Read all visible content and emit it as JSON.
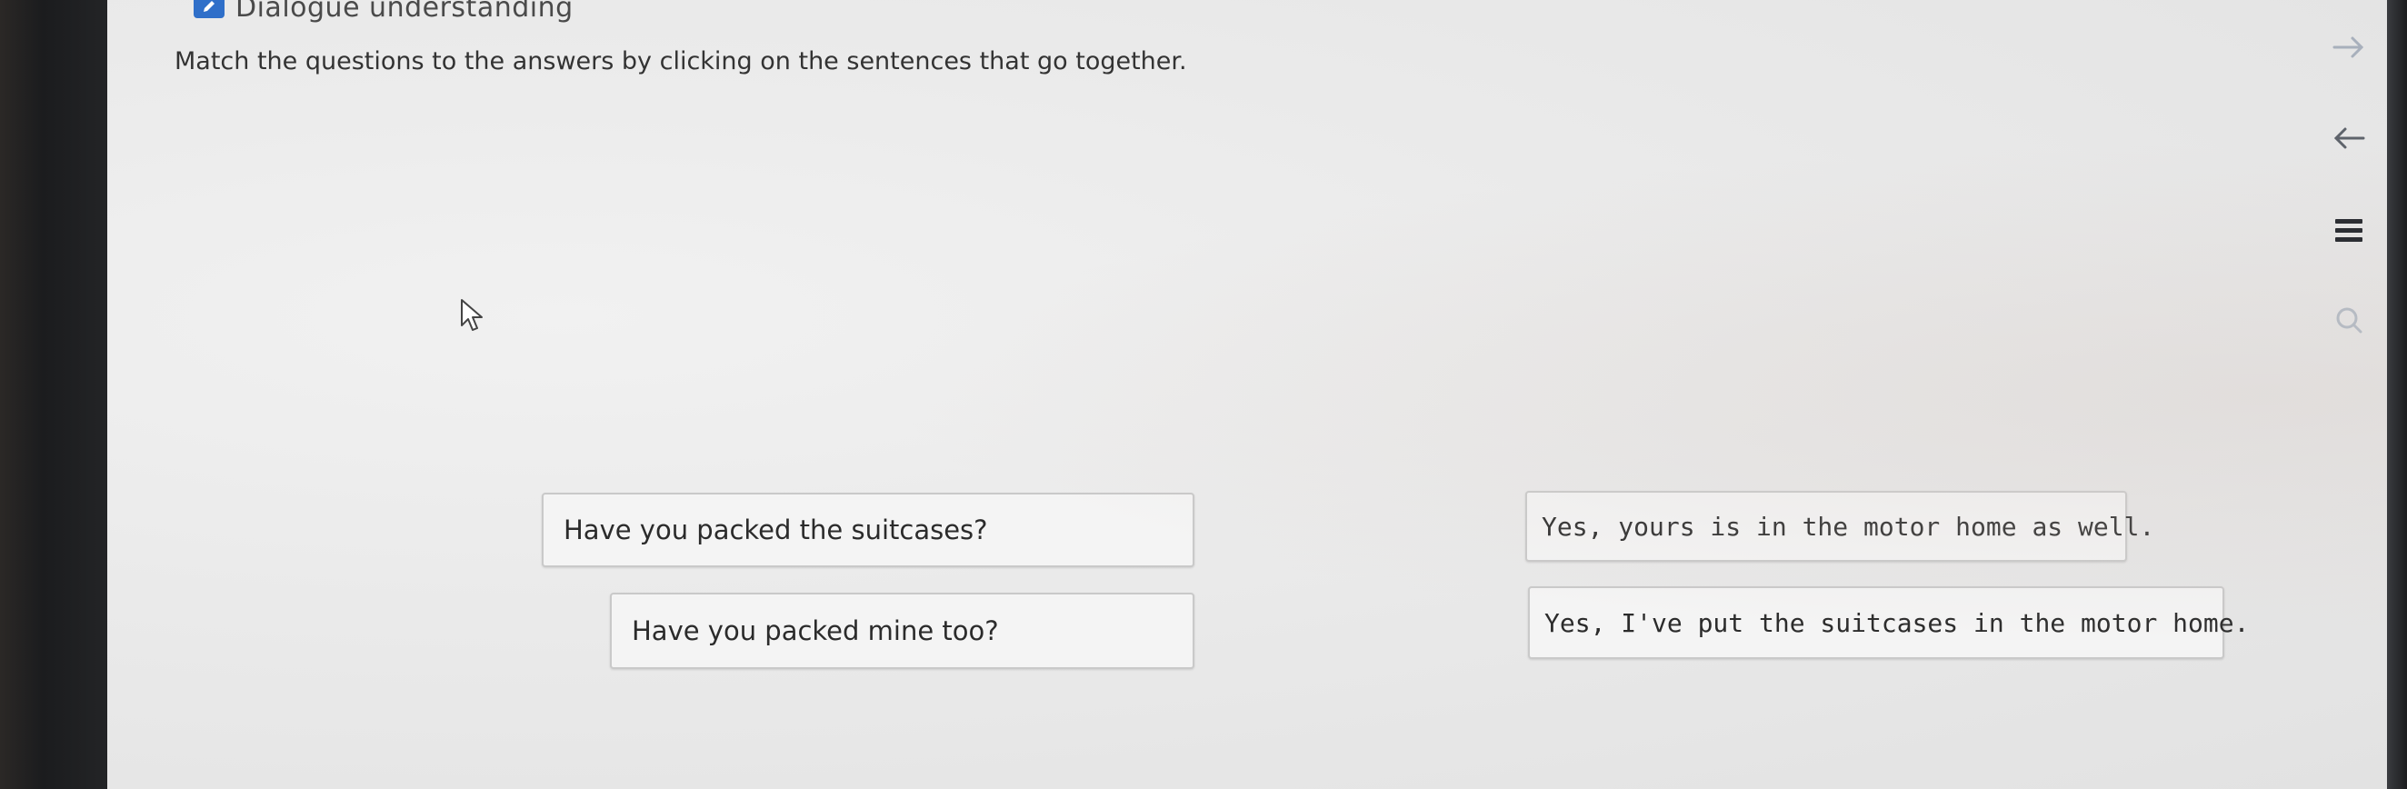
{
  "header": {
    "title": "Dialogue understanding",
    "instruction": "Match the questions to the answers by clicking on the sentences that go together."
  },
  "questions": [
    {
      "text": "Have you packed the suitcases?"
    },
    {
      "text": "Have you packed mine too?"
    }
  ],
  "answers": [
    {
      "text": "Yes, yours is in the motor home as well."
    },
    {
      "text": "Yes, I've put the suitcases in the motor home."
    }
  ],
  "sidebar": {
    "icons": [
      "arrow-right-icon",
      "arrow-left-icon",
      "menu-icon",
      "search-icon"
    ]
  },
  "colors": {
    "accent": "#2f6fc9",
    "tile_border": "#c9c9c9",
    "tile_bg": "#f4f4f4"
  }
}
